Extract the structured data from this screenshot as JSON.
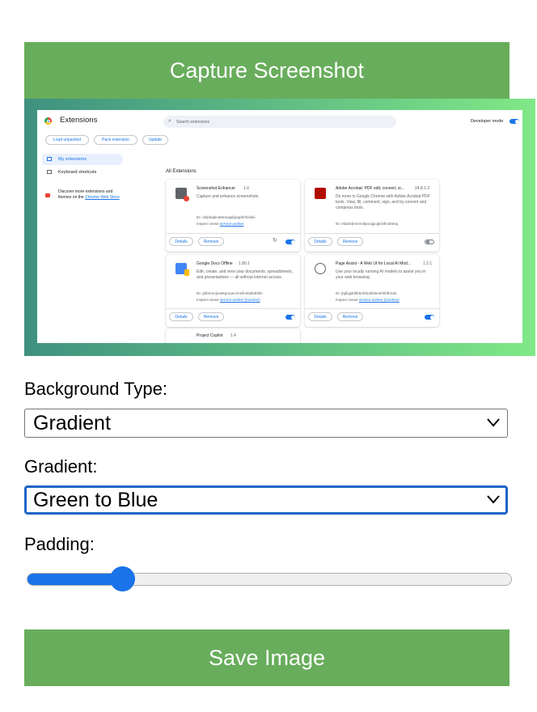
{
  "capture_button": "Capture Screenshot",
  "preview": {
    "gradient_colors": [
      "#3f9180",
      "#80e887"
    ],
    "extensions_page": {
      "title": "Extensions",
      "search_placeholder": "Search extensions",
      "developer_mode_label": "Developer mode",
      "developer_mode_on": true,
      "toolbar": [
        "Load unpacked",
        "Pack extension",
        "Update"
      ],
      "sidebar": {
        "items": [
          "My extensions",
          "Keyboard shortcuts"
        ],
        "discover_text": "Discover more extensions and themes on the",
        "discover_link": "Chrome Web Store"
      },
      "section_title": "All Extensions",
      "cards": [
        {
          "name": "Screenshot Enhancer",
          "version": "1.0",
          "description": "Capture and enhance screenshots",
          "id": "ID: dolpkaplnebemajabjegehhfoioiki",
          "inspect_label": "Inspect views",
          "inspect_link": "service worker",
          "details": "Details",
          "remove": "Remove",
          "enabled": true
        },
        {
          "name": "Adobe Acrobat: PDF edit, convert, si...",
          "version": "24.8.1.3",
          "description": "Do more in Google Chrome with Adobe Acrobat PDF tools. View, fill, comment, sign, and try convert and compress tools.",
          "id": "ID: efaidnbmnnnibpcajpcglclefindmkaj",
          "details": "Details",
          "remove": "Remove",
          "enabled": false
        },
        {
          "name": "Google Docs Offline",
          "version": "1.80.1",
          "description": "Edit, create, and view your documents, spreadsheets, and presentations — all without internet access.",
          "id": "ID: ghbmnnjooekpmoecnnnilnnbdlolhkhi",
          "inspect_label": "Inspect views",
          "inspect_link": "service worker (Inactive)",
          "details": "Details",
          "remove": "Remove",
          "enabled": true
        },
        {
          "name": "Page Assist - A Web UI for Local AI Mod...",
          "version": "1.2.1",
          "description": "Use your locally running AI models to assist you in your web browsing.",
          "id": "ID: jfgfiigpkhlkbnfnbobbkinehhfdhndo",
          "inspect_label": "Inspect views",
          "inspect_link": "service worker (Inactive)",
          "details": "Details",
          "remove": "Remove",
          "enabled": true
        },
        {
          "name": "Project Copilot",
          "version": "1.4"
        }
      ]
    }
  },
  "background_type": {
    "label": "Background Type:",
    "value": "Gradient"
  },
  "gradient": {
    "label": "Gradient:",
    "value": "Green to Blue"
  },
  "padding": {
    "label": "Padding:",
    "value_percent": 19,
    "accent": "#1a73e8"
  },
  "save_button": "Save Image"
}
